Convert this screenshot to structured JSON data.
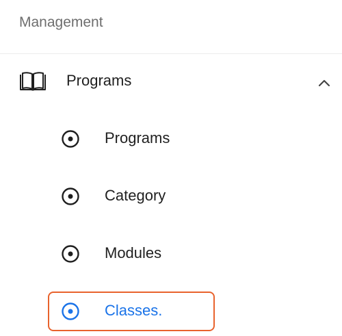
{
  "section": {
    "title": "Management"
  },
  "group": {
    "label": "Programs",
    "icon": "book-open-icon",
    "expanded": true,
    "chevron_icon": "chevron-up-icon"
  },
  "sub_items": [
    {
      "label": "Programs",
      "icon": "radio-dot-icon",
      "active": false
    },
    {
      "label": "Category",
      "icon": "radio-dot-icon",
      "active": false
    },
    {
      "label": "Modules",
      "icon": "radio-dot-icon",
      "active": false
    },
    {
      "label": "Classes.",
      "icon": "radio-dot-icon",
      "active": true
    }
  ],
  "colors": {
    "active_text": "#1a73e8",
    "highlight_border": "#e8622c",
    "text": "#1f1f1f",
    "muted": "#6e6e6e"
  }
}
